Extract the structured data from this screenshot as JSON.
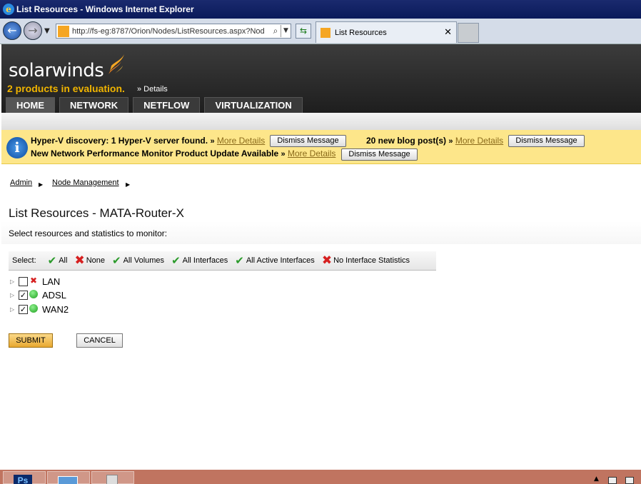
{
  "window": {
    "title": "List Resources - Windows Internet Explorer"
  },
  "browser": {
    "url": "http://fs-eg:8787/Orion/Nodes/ListResources.aspx?Nod",
    "tab_title": "List Resources",
    "back_glyph": "←",
    "forward_glyph": "→",
    "search_glyph": "⌕",
    "refresh_glyph": "⇆",
    "close_glyph": "✕"
  },
  "header": {
    "logo_text": "solarwinds",
    "evaluation_text": "2 products in evaluation.",
    "crumb": "» Details",
    "nav_tabs": [
      "HOME",
      "NETWORK",
      "NETFLOW",
      "VIRTUALIZATION"
    ]
  },
  "notifications": {
    "line1": {
      "text": "Hyper-V discovery: 1 Hyper-V server found.",
      "arrow": "»",
      "link": "More Details",
      "dismiss": "Dismiss Message"
    },
    "line1b": {
      "text": "20 new blog post(s)",
      "arrow": "»",
      "link": "More Details",
      "dismiss": "Dismiss Message"
    },
    "line2": {
      "text": "New Network Performance Monitor Product Update Available",
      "arrow": "»",
      "link": "More Details",
      "dismiss": "Dismiss Message"
    }
  },
  "breadcrumbs": [
    "Admin",
    "Node Management"
  ],
  "page": {
    "title": "List Resources - MATA-Router-X",
    "subtitle": "Select resources and statistics to monitor:"
  },
  "select_bar": {
    "label": "Select:",
    "options": [
      {
        "label": "All",
        "icon": "check"
      },
      {
        "label": "None",
        "icon": "x"
      },
      {
        "label": "All Volumes",
        "icon": "check"
      },
      {
        "label": "All Interfaces",
        "icon": "check"
      },
      {
        "label": "All Active Interfaces",
        "icon": "check"
      },
      {
        "label": "No Interface Statistics",
        "icon": "x"
      }
    ]
  },
  "resources": [
    {
      "name": "LAN",
      "checked": false,
      "status": "down"
    },
    {
      "name": "ADSL",
      "checked": true,
      "status": "up"
    },
    {
      "name": "WAN2",
      "checked": true,
      "status": "up"
    }
  ],
  "buttons": {
    "submit": "SUBMIT",
    "cancel": "CANCEL"
  },
  "taskbar": {
    "ps_label": "Ps"
  },
  "colors": {
    "accent": "#f0b400",
    "notify_bg": "#fde68a",
    "taskbar": "#c07460",
    "status_up": "#1ea01e",
    "status_down": "#d62020"
  }
}
